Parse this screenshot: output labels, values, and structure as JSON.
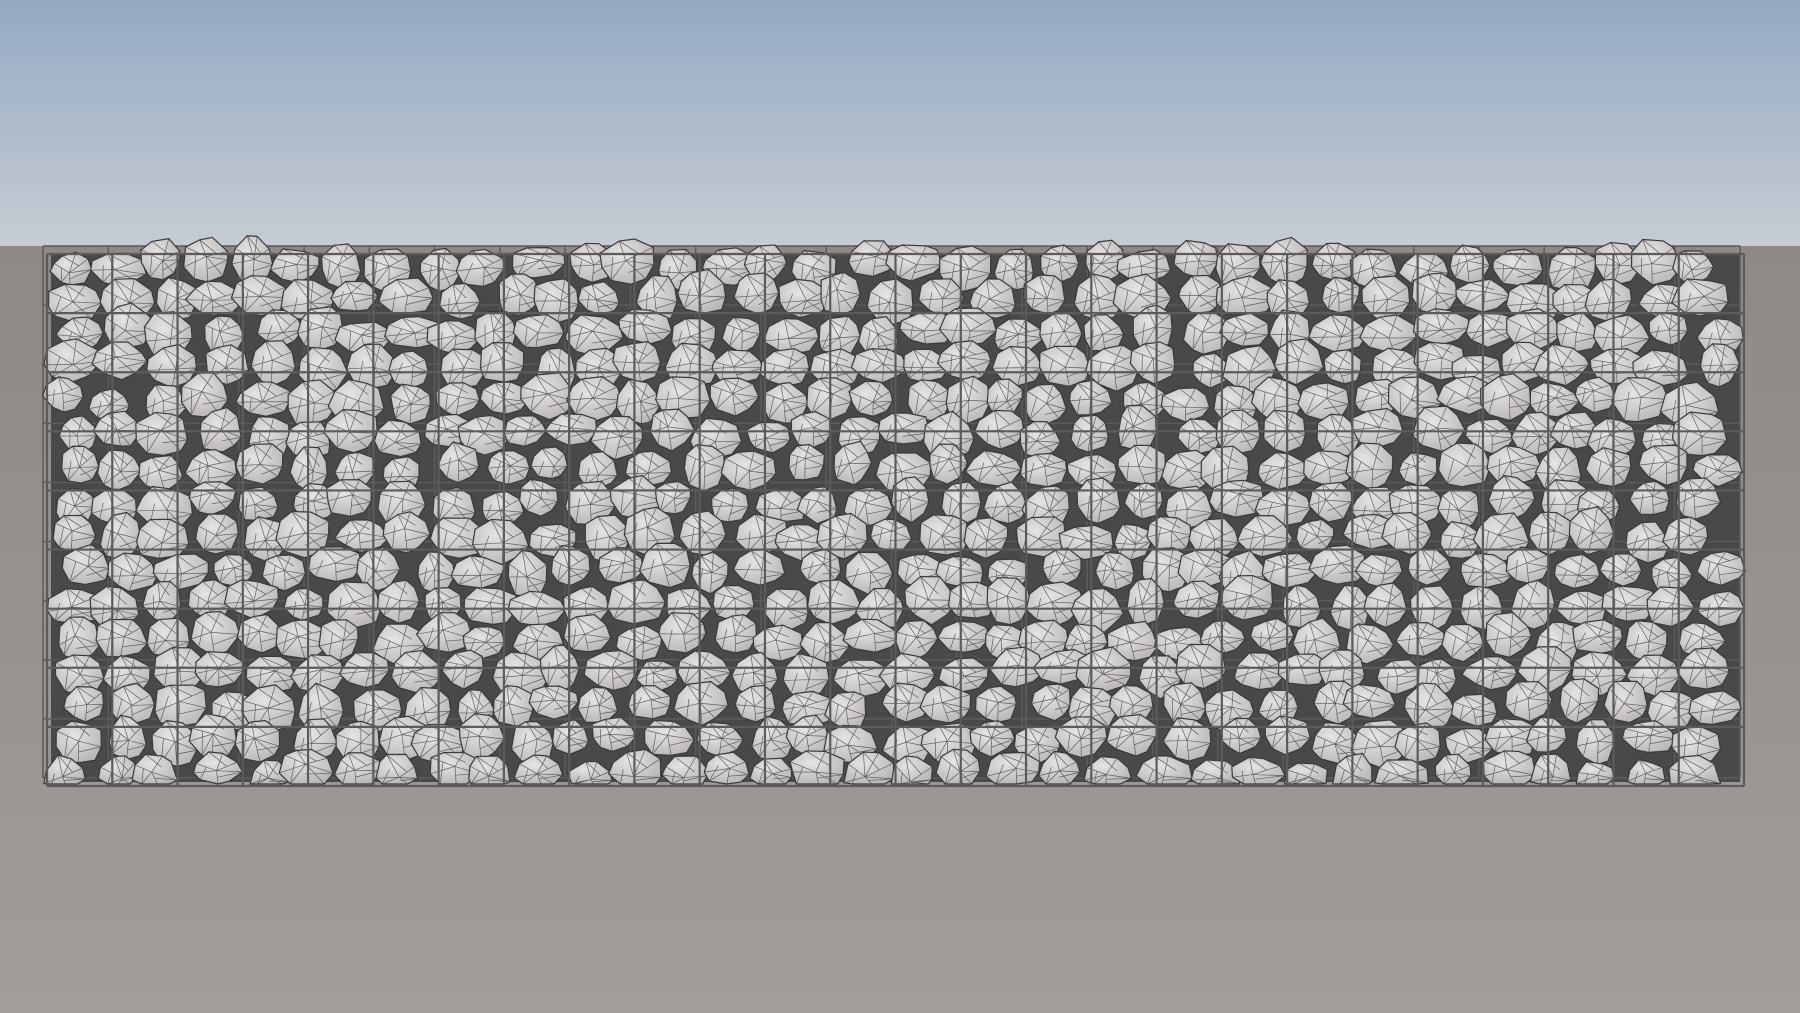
{
  "scene": {
    "subject": "gabion wall",
    "colors": {
      "sky_top": "#93aac4",
      "sky_bottom": "#c7ccd3",
      "ground_top": "#8f8985",
      "ground_bottom": "#a29c9a",
      "rock_fill": "#e6e3e3",
      "rock_shade": "#b9b5b6",
      "rock_wire": "#3a3a3a",
      "cage_wire": "#5c5a5a"
    },
    "cage": {
      "columns": 26,
      "rows": 9
    }
  }
}
